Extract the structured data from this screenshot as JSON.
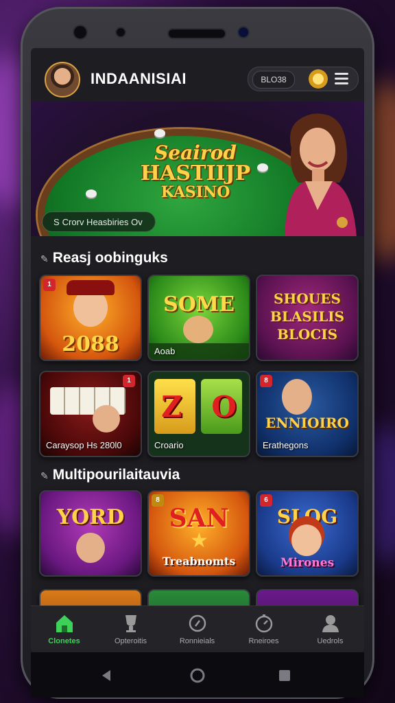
{
  "app": {
    "brand": "INDAANISIAI",
    "badge_label": "BLO38",
    "accent": "#3ed15a",
    "brand_gold": "#ffd24a"
  },
  "banner": {
    "title_line1": "Seairod",
    "title_line2": "HASTIIJP",
    "title_line3": "KASINO",
    "cta_prefix": "S",
    "cta_text": "Crorv Heasbiries Ov"
  },
  "section1": {
    "title": "Reasj oobinguks",
    "icon": "pin-icon",
    "tiles": [
      {
        "tag": "1",
        "big": "2088",
        "caption": ""
      },
      {
        "tag": "",
        "big": "SOME",
        "caption": "Aoab"
      },
      {
        "tag": "",
        "big": "SHOUES BLASILIS BLOCIS",
        "caption": ""
      },
      {
        "tag": "1",
        "big": "",
        "caption": "Caraysop Hs 280l0"
      },
      {
        "tag": "",
        "big": "Z O",
        "caption": "Croario"
      },
      {
        "tag": "8",
        "big": "ENNIOIRO",
        "caption": "Erathegons"
      }
    ]
  },
  "section2": {
    "title": "Multipourilaitauvia",
    "icon": "pin-icon",
    "tiles": [
      {
        "tag": "",
        "big": "YORD",
        "caption": ""
      },
      {
        "tag": "8",
        "big": "SAN",
        "caption": "Treabnomts"
      },
      {
        "tag": "6",
        "big": "SLOG",
        "caption": "Mirones"
      }
    ]
  },
  "nav": {
    "items": [
      {
        "label": "Clonetes",
        "icon": "home-icon"
      },
      {
        "label": "Opteroitis",
        "icon": "trophy-icon"
      },
      {
        "label": "Ronnieials",
        "icon": "search-icon"
      },
      {
        "label": "Rneiroes",
        "icon": "clock-icon"
      },
      {
        "label": "Uedrols",
        "icon": "user-icon"
      }
    ]
  }
}
